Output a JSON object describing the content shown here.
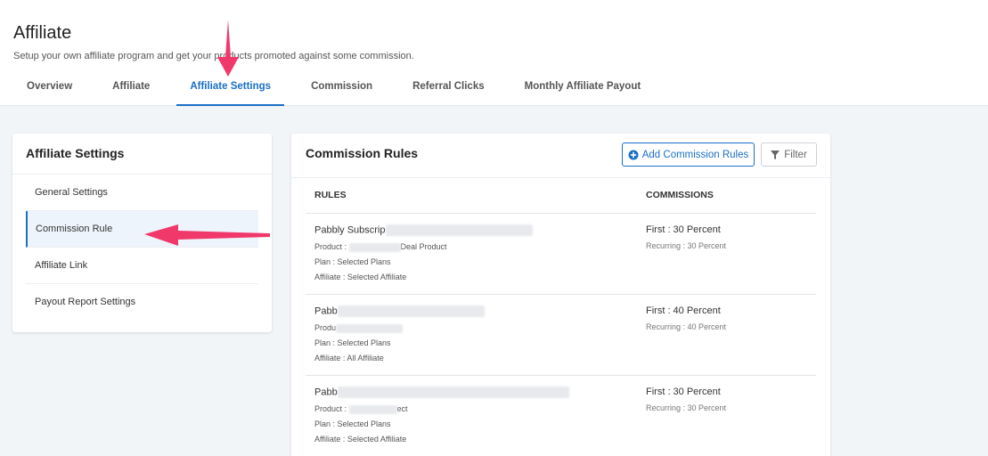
{
  "header": {
    "title": "Affiliate",
    "subtitle": "Setup your own affiliate program and get your products promoted against some commission."
  },
  "tabs": [
    {
      "label": "Overview"
    },
    {
      "label": "Affiliate"
    },
    {
      "label": "Affiliate Settings"
    },
    {
      "label": "Commission"
    },
    {
      "label": "Referral Clicks"
    },
    {
      "label": "Monthly Affiliate Payout"
    }
  ],
  "sidebar": {
    "title": "Affiliate Settings",
    "items": [
      {
        "label": "General Settings"
      },
      {
        "label": "Commission Rule"
      },
      {
        "label": "Affiliate Link"
      },
      {
        "label": "Payout Report Settings"
      }
    ]
  },
  "main": {
    "title": "Commission Rules",
    "add_label": "Add Commission Rules",
    "filter_label": "Filter",
    "col_rules": "RULES",
    "col_commissions": "COMMISSIONS",
    "rows": [
      {
        "name": "Pabbly Subscrip",
        "product_prefix": "Product : ",
        "product_suffix": "Deal Product",
        "plan": "Plan : Selected Plans",
        "affiliate": "Affiliate : Selected Affiliate",
        "first": "First : 30 Percent",
        "recurring": "Recurring : 30 Percent"
      },
      {
        "name": "Pabb",
        "product_prefix": "Produ",
        "product_suffix": "",
        "plan": "Plan : Selected Plans",
        "affiliate": "Affiliate : All Affiliate",
        "first": "First : 40 Percent",
        "recurring": "Recurring : 40 Percent"
      },
      {
        "name": "Pabb",
        "product_prefix": "Product : ",
        "product_suffix": "ect",
        "plan": "Plan : Selected Plans",
        "affiliate": "Affiliate : Selected Affiliate",
        "first": "First : 30 Percent",
        "recurring": "Recurring : 30 Percent"
      }
    ]
  },
  "colors": {
    "accent": "#1a6fc7",
    "annotation_arrow": "#f0386b"
  }
}
